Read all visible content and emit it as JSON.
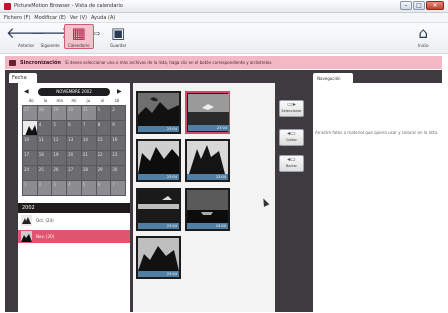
{
  "window": {
    "title": "PictureMotion Browser - Vista de calendario"
  },
  "menu": {
    "items": [
      "Fichero (F)",
      "Modificar (E)",
      "Ver (V)",
      "Ayuda (A)"
    ]
  },
  "toolbar": {
    "buttons": [
      {
        "label": "Anterior",
        "icon": "arrow-left-icon"
      },
      {
        "label": "Siguiente",
        "icon": "arrow-right-icon"
      },
      {
        "label": "Calendario",
        "icon": "calendar-icon"
      },
      {
        "label": "Guardar",
        "icon": "floppy-icon"
      },
      {
        "label": "Inicio",
        "icon": "home-icon"
      }
    ]
  },
  "notice": {
    "title": "Sincronización",
    "text": "Si desea seleccionar uno o más archivos de la lista, haga clic en el botón correspondiente y arrástrelos."
  },
  "left_tab": "Fecha",
  "calendar": {
    "month_label": "NOVIEMBRE 2002",
    "weekdays": [
      "do",
      "lu",
      "ma",
      "mi",
      "ju",
      "vi",
      "sá"
    ],
    "days": [
      "27",
      "28",
      "29",
      "30",
      "31",
      "1",
      "2",
      "3",
      "4",
      "5",
      "6",
      "7",
      "8",
      "9",
      "10",
      "11",
      "12",
      "13",
      "14",
      "15",
      "16",
      "17",
      "18",
      "19",
      "20",
      "21",
      "22",
      "23",
      "24",
      "25",
      "26",
      "27",
      "28",
      "29",
      "30",
      "1",
      "2",
      "3",
      "4",
      "5",
      "6",
      "7"
    ]
  },
  "year_label": "2002",
  "months": [
    {
      "label": "Oct. (24)",
      "selected": false
    },
    {
      "label": "Nov. (20)",
      "selected": true
    }
  ],
  "thumbnails": [
    {
      "caption": "23:04",
      "selected": false
    },
    {
      "caption": "23:04",
      "selected": true
    },
    {
      "caption": "23:04",
      "selected": false
    },
    {
      "caption": "23:04",
      "selected": false
    },
    {
      "caption": "23:04",
      "selected": false
    },
    {
      "caption": "23:04",
      "selected": false
    },
    {
      "caption": "23:04",
      "selected": false
    }
  ],
  "actions": [
    {
      "label": "Seleccionar",
      "icon": "select-icon"
    },
    {
      "label": "Quitar",
      "icon": "remove-icon"
    },
    {
      "label": "Borrar",
      "icon": "clear-icon"
    }
  ],
  "right_tab": "Navegación",
  "right_hint": "Arrastre fotos o material que quiera usar y colocar en la lista.",
  "colors": {
    "accent": "#e05670",
    "selected_border": "#d6476a",
    "caption_bar": "#4f7fa5",
    "panel_dark": "#3e3a40"
  }
}
